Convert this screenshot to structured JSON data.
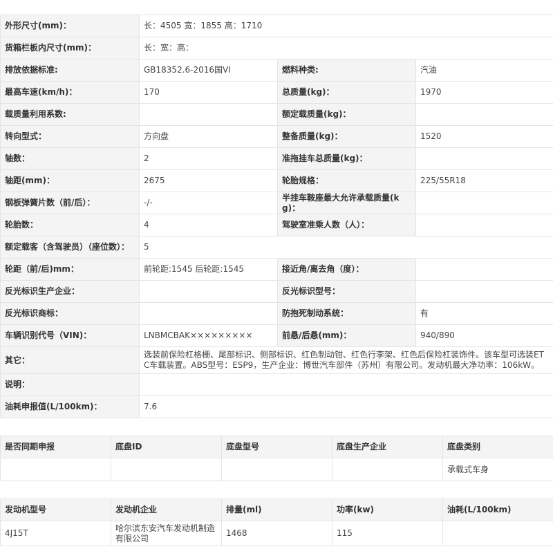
{
  "spec": {
    "rows": [
      {
        "l1": "外形尺寸(mm)：",
        "v1": "长：4505 宽：1855 高：1710",
        "span": true
      },
      {
        "l1": "货箱栏板内尺寸(mm)：",
        "v1": "长：宽：高：",
        "span": true
      },
      {
        "l1": "排放依据标准:",
        "v1": "GB18352.6-2016国VI",
        "l2": "燃料种类:",
        "v2": "汽油"
      },
      {
        "l1": "最高车速(km/h)：",
        "v1": "170",
        "l2": "总质量(kg)：",
        "v2": "1970"
      },
      {
        "l1": "载质量利用系数:",
        "v1": "",
        "l2": "额定载质量(kg)：",
        "v2": ""
      },
      {
        "l1": "转向型式：",
        "v1": "方向盘",
        "l2": "整备质量(kg)：",
        "v2": "1520"
      },
      {
        "l1": "轴数：",
        "v1": "2",
        "l2": "准拖挂车总质量(kg)：",
        "v2": ""
      },
      {
        "l1": "轴距(mm)：",
        "v1": "2675",
        "l2": "轮胎规格：",
        "v2": "225/55R18"
      },
      {
        "l1": "钢板弹簧片数（前/后）：",
        "v1": "-/-",
        "l2": "半挂车鞍座最大允许承载质量(kg)：",
        "v2": ""
      },
      {
        "l1": "轮胎数：",
        "v1": "4",
        "l2": "驾驶室准乘人数（人）：",
        "v2": ""
      },
      {
        "l1": "额定载客（含驾驶员）（座位数）：",
        "v1": "5",
        "span": true
      },
      {
        "l1": "轮距（前/后)mm：",
        "v1": "前轮距:1545 后轮距:1545",
        "l2": "接近角/离去角（度）：",
        "v2": ""
      },
      {
        "l1": "反光标识生产企业：",
        "v1": "",
        "l2": "反光标识型号：",
        "v2": ""
      },
      {
        "l1": "反光标识商标：",
        "v1": "",
        "l2": "防抱死制动系统：",
        "v2": "有"
      },
      {
        "l1": "车辆识别代号（VIN)：",
        "v1": "LNBMCBAK×××××××××",
        "l2": "前悬/后悬(mm)：",
        "v2": "940/890"
      },
      {
        "l1": "其它：",
        "v1": "选装前保险杠格栅、尾部标识、侧部标识、红色制动钳、红色行李架、红色后保险杠装饰件。该车型可选装ETC车载装置。ABS型号：ESP9，生产企业：博世汽车部件（苏州）有限公司。发动机最大净功率：106kW。",
        "span": true,
        "tall": true
      },
      {
        "l1": "说明：",
        "v1": "",
        "span": true
      },
      {
        "l1": "油耗申报值(L/100km)：",
        "v1": "7.6",
        "span": true
      }
    ]
  },
  "chassis": {
    "headers": [
      "是否同期申报",
      "底盘ID",
      "底盘型号",
      "底盘生产企业",
      "底盘类别"
    ],
    "row": [
      "",
      "",
      "",
      "",
      "承载式车身"
    ]
  },
  "engine": {
    "headers": [
      "发动机型号",
      "发动机企业",
      "排量(ml)",
      "功率(kw)",
      "油耗(L/100km)"
    ],
    "row": [
      "4J15T",
      "哈尔滨东安汽车发动机制造有限公司",
      "1468",
      "115",
      ""
    ]
  }
}
